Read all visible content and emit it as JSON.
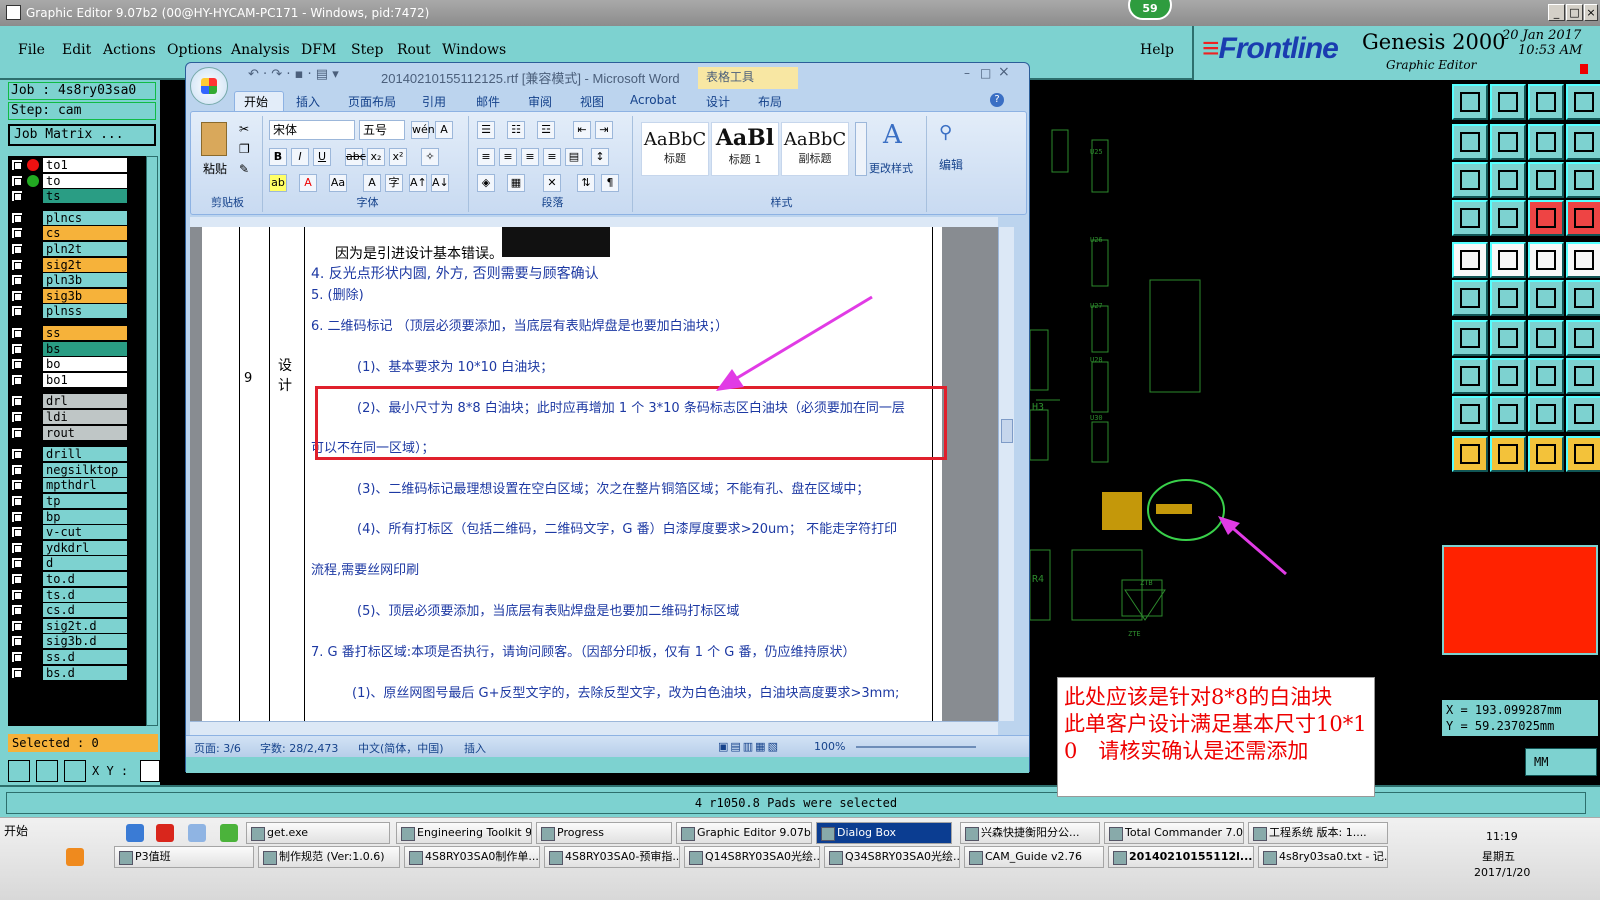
{
  "genesis": {
    "title": "Graphic Editor 9.07b2 (00@HY-HYCAM-PC171 - Windows, pid:7472)",
    "clock_badge": "59",
    "menu": [
      "File",
      "Edit",
      "Actions",
      "Options",
      "Analysis",
      "DFM",
      "Step",
      "Rout",
      "Windows"
    ],
    "help": "Help",
    "logo": {
      "brand_prefix": "≡",
      "brand": "Frontline",
      "product": "Genesis 2000",
      "subtitle": "Graphic Editor",
      "date": "20 Jan 2017",
      "time": "10:53 AM"
    },
    "job": "Job : 4s8ry03sa0",
    "step": "Step: cam",
    "job_matrix": "Job Matrix ...",
    "layers": [
      {
        "name": "to1",
        "color": "white"
      },
      {
        "name": "to",
        "color": "white"
      },
      {
        "name": "ts",
        "color": "teal"
      },
      {
        "name": "plncs",
        "color": "cyan"
      },
      {
        "name": "cs",
        "color": "orange"
      },
      {
        "name": "pln2t",
        "color": "cyan"
      },
      {
        "name": "sig2t",
        "color": "orange"
      },
      {
        "name": "pln3b",
        "color": "cyan"
      },
      {
        "name": "sig3b",
        "color": "orange"
      },
      {
        "name": "plnss",
        "color": "cyan"
      },
      {
        "name": "ss",
        "color": "orange"
      },
      {
        "name": "bs",
        "color": "teal"
      },
      {
        "name": "bo",
        "color": "white"
      },
      {
        "name": "bo1",
        "color": "white"
      },
      {
        "name": "drl",
        "color": "gray"
      },
      {
        "name": "ldi",
        "color": "gray"
      },
      {
        "name": "rout",
        "color": "gray"
      },
      {
        "name": "drill",
        "color": "cyan"
      },
      {
        "name": "negsilktop",
        "color": "cyan"
      },
      {
        "name": "mpthdrl",
        "color": "cyan"
      },
      {
        "name": "tp",
        "color": "cyan"
      },
      {
        "name": "bp",
        "color": "cyan"
      },
      {
        "name": "v-cut",
        "color": "cyan"
      },
      {
        "name": "ydkdrl",
        "color": "cyan"
      },
      {
        "name": "d",
        "color": "cyan"
      },
      {
        "name": "to.d",
        "color": "cyan"
      },
      {
        "name": "ts.d",
        "color": "cyan"
      },
      {
        "name": "cs.d",
        "color": "cyan"
      },
      {
        "name": "sig2t.d",
        "color": "cyan"
      },
      {
        "name": "sig3b.d",
        "color": "cyan"
      },
      {
        "name": "ss.d",
        "color": "cyan"
      },
      {
        "name": "bs.d",
        "color": "cyan"
      }
    ],
    "selected": "Selected : 0",
    "xy_label": "X Y :",
    "status": "4 r1050.8 Pads were selected",
    "coords": {
      "x": "X  =  193.099287mm",
      "y": "Y  =  59.237025mm"
    },
    "units": "MM",
    "cam_labels": [
      "U25",
      "U26",
      "U27",
      "U28",
      "U30",
      "ZTB",
      "ZTE",
      "H3",
      "R4"
    ]
  },
  "word": {
    "title": "20140210155112125.rtf [兼容模式] - Microsoft Word",
    "tools_tab": "表格工具",
    "tabs": [
      "开始",
      "插入",
      "页面布局",
      "引用",
      "邮件",
      "审阅",
      "视图",
      "Acrobat",
      "设计",
      "布局"
    ],
    "ribbon": {
      "clipboard": {
        "paste": "粘贴",
        "label": "剪贴板"
      },
      "font": {
        "name": "宋体",
        "size": "五号",
        "label": "字体"
      },
      "paragraph": {
        "label": "段落"
      },
      "styles": {
        "label": "样式",
        "items": [
          {
            "preview": "AaBbC",
            "caption": "标题"
          },
          {
            "preview": "AaBl",
            "caption": "标题 1"
          },
          {
            "preview": "AaBbC",
            "caption": "副标题"
          }
        ],
        "change": "更改样式"
      },
      "edit": {
        "label": "编辑"
      }
    },
    "doc": {
      "row_no": "9",
      "row_cat": [
        "设",
        "计"
      ],
      "lines": [
        "因为是引进设计基本错误。",
        "4. 反光点形状内圆, 外方, 否则需要与顾客确认",
        "5. (删除)",
        "6. 二维码标记 （顶层必须要添加，当底层有表贴焊盘是也要加白油块；）",
        "(1)、基本要求为 10*10 白油块；",
        "(2)、最小尺寸为 8*8 白油块；此时应再增加 1 个 3*10 条码标志区白油块（必须要加在同一层",
        "可以不在同一区域）；",
        "(3)、二维码标记最理想设置在空白区域；次之在整片铜箔区域；不能有孔、盘在区域中；",
        "(4)、所有打标区（包括二维码，二维码文字，G 番）白漆厚度要求>20um；  不能走字符打印",
        "流程,需要丝网印刷",
        "(5)、顶层必须要添加，当底层有表贴焊盘是也要加二维码打标区域",
        "7. G 番打标区域:本项是否执行，请询问顾客。（因部分印板，仅有 1 个 G 番，仍应维持原状）",
        "(1)、原丝网图号最后 G+反型文字的，去除反型文字，改为白色油块，白油块高度要求>3mm;"
      ]
    },
    "status": {
      "page": "页面: 3/6",
      "words": "字数: 28/2,473",
      "lang": "中文(简体，中国)",
      "mode": "插入",
      "zoom": "100%"
    }
  },
  "note": "此处应该是针对8*8的白油块　此单客户设计满足基本尺寸10*10　请核实确认是还需添加",
  "taskbar": {
    "start": "开始",
    "row1": [
      "get.exe",
      "Engineering Toolkit 9....",
      "Progress",
      "Graphic Editor 9.07b2...",
      "Dialog Box",
      "兴森快捷衡阳分公...",
      "Total Commander 7.0...",
      "工程系统  版本: 1...."
    ],
    "row2": [
      "P3值班",
      "制作规范 (Ver:1.0.6)",
      "4S8RY03SA0制作单...",
      "4S8RY03SA0-预审指...",
      "Q14S8RY03SA0光绘...",
      "Q34S8RY03SA0光绘...",
      "CAM_Guide v2.76",
      "20140210155112l...",
      "4s8ry03sa0.txt - 记..."
    ],
    "time": "11:19",
    "weekday": "星期五",
    "date": "2017/1/20"
  }
}
